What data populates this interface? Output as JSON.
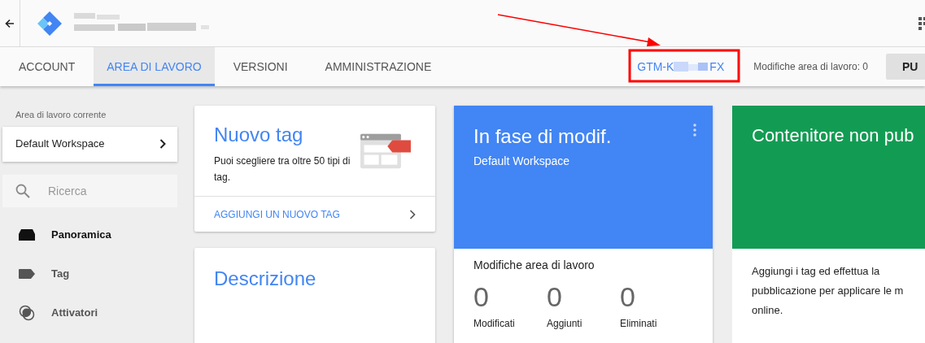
{
  "tabs": [
    {
      "label": "ACCOUNT",
      "selected": false
    },
    {
      "label": "AREA DI LAVORO",
      "selected": true
    },
    {
      "label": "VERSIONI",
      "selected": false
    },
    {
      "label": "AMMINISTRAZIONE",
      "selected": false
    }
  ],
  "container_id": {
    "prefix": "GTM-K",
    "suffix": "FX"
  },
  "workspace_changes": "Modifiche area di lavoro: 0",
  "publish_button": "PU",
  "sidebar": {
    "label": "Area di lavoro corrente",
    "workspace": "Default Workspace",
    "search_placeholder": "Ricerca",
    "items": [
      {
        "label": "Panoramica",
        "kind": "overview",
        "selected": true
      },
      {
        "label": "Tag",
        "kind": "tag",
        "selected": false
      },
      {
        "label": "Attivatori",
        "kind": "trigger",
        "selected": false
      }
    ]
  },
  "new_tag_card": {
    "title": "Nuovo tag",
    "text": "Puoi scegliere tra oltre 50 tipi di tag.",
    "action": "AGGIUNGI UN NUOVO TAG"
  },
  "description_card": {
    "title": "Descrizione"
  },
  "editing_card": {
    "title": "In fase di modif.",
    "subtitle": "Default Workspace",
    "changes_title": "Modifiche area di lavoro",
    "stats": [
      {
        "value": "0",
        "label": "Modificati"
      },
      {
        "value": "0",
        "label": "Aggiunti"
      },
      {
        "value": "0",
        "label": "Eliminati"
      }
    ]
  },
  "unpublished_card": {
    "title": "Contenitore non pub",
    "lines": [
      "Aggiungi i tag ed effettua la",
      "pubblicazione per applicare le m",
      "online."
    ]
  }
}
